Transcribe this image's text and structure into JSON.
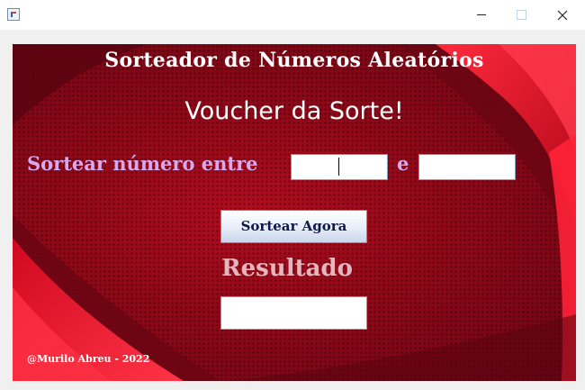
{
  "window": {
    "icons": {
      "app": "java-icon",
      "minimize": "minimize-icon",
      "maximize": "maximize-icon",
      "close": "close-icon"
    }
  },
  "app": {
    "title": "Sorteador de Números Aleatórios",
    "subtitle": "Voucher da Sorte!",
    "range_label": "Sortear número entre",
    "and_label": "e",
    "min_value": "",
    "max_value": "",
    "button_label": "Sortear Agora",
    "result_label": "Resultado",
    "result_value": "",
    "footer": "@Murilo Abreu - 2022"
  },
  "colors": {
    "background": "#8e0818",
    "accent_red": "#e8102a",
    "range_label": "#d6a8ef",
    "result_label": "#e3b7bd"
  }
}
